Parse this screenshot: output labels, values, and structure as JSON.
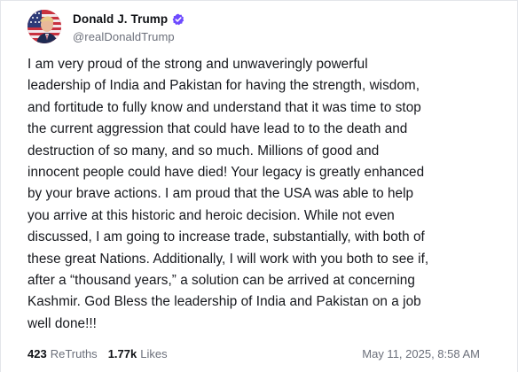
{
  "author": {
    "display_name": "Donald J. Trump",
    "handle": "@realDonaldTrump",
    "verified_color": "#6d4aff",
    "avatar_icon": "flag-avatar"
  },
  "post": {
    "text": "I am very proud of the strong and unwaveringly powerful\nleadership of India and Pakistan for having the strength, wisdom,\nand fortitude to fully know and understand that it was time to stop\nthe current aggression that could have lead to to the death and\ndestruction of so many, and so much. Millions of good and\ninnocent people could have died! Your legacy is greatly enhanced\nby your brave actions. I am proud that the USA was able to help\nyou arrive at this historic and heroic decision. While not even\ndiscussed, I am going to increase trade, substantially, with both of\nthese great Nations. Additionally, I will work with you both to see if,\nafter a “thousand years,” a solution can be arrived at concerning\nKashmir. God Bless the leadership of India and Pakistan on a job\nwell done!!!"
  },
  "stats": {
    "retruths_count": "423",
    "retruths_label": "ReTruths",
    "likes_count": "1.77k",
    "likes_label": "Likes"
  },
  "timestamp": "May 11, 2025, 8:58 AM"
}
